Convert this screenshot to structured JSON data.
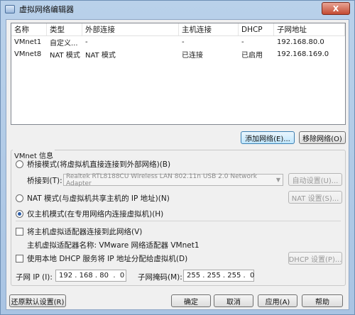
{
  "window": {
    "title": "虚拟网络编辑器",
    "close": "X"
  },
  "table": {
    "headers": [
      "名称",
      "类型",
      "外部连接",
      "主机连接",
      "DHCP",
      "子网地址"
    ],
    "rows": [
      [
        "VMnet1",
        "自定义...",
        "-",
        "-",
        "-",
        "192.168.80.0"
      ],
      [
        "VMnet8",
        "NAT 模式",
        "NAT 模式",
        "已连接",
        "已启用",
        "192.168.169.0"
      ]
    ]
  },
  "buttons": {
    "add_network": "添加网络(E)...",
    "remove_network": "移除网络(O)",
    "auto_settings": "自动设置(U)...",
    "nat_settings": "NAT 设置(S)...",
    "dhcp_settings": "DHCP 设置(P)...",
    "restore_defaults": "还原默认设置(R)",
    "ok": "确定",
    "cancel": "取消",
    "apply": "应用(A)",
    "help": "帮助"
  },
  "vmnet_info": {
    "title": "VMnet 信息",
    "bridged_label": "桥接模式(将虚拟机直接连接到外部网络)(B)",
    "bridged_to_label": "桥接到(T):",
    "bridged_to_value": "Realtek RTL8188CU Wireless LAN 802.11n USB 2.0 Network Adapter",
    "nat_label": "NAT 模式(与虚拟机共享主机的 IP 地址)(N)",
    "host_only_label": "仅主机模式(在专用网络内连接虚拟机)(H)",
    "connect_adapter_label": "将主机虚拟适配器连接到此网络(V)",
    "adapter_name_label": "主机虚拟适配器名称: VMware 网络适配器 VMnet1",
    "use_dhcp_label": "使用本地 DHCP 服务将 IP 地址分配给虚拟机(D)",
    "subnet_ip_label": "子网 IP (I):",
    "subnet_ip_value": "192 . 168 . 80  .  0",
    "subnet_mask_label": "子网掩码(M):",
    "subnet_mask_value": "255 . 255 . 255 .  0"
  }
}
